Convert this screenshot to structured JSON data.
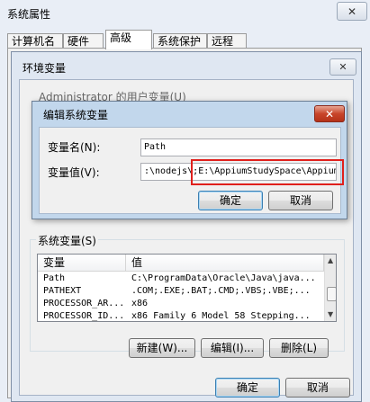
{
  "outer": {
    "title": "系统属性",
    "tabs": [
      "计算机名",
      "硬件",
      "高级",
      "系统保护",
      "远程"
    ],
    "active_tab": "高级"
  },
  "env": {
    "title": "环境变量",
    "user_vars_label": "Administrator 的用户变量(U)",
    "system_vars_label": "系统变量(S)",
    "columns": [
      "变量",
      "值"
    ],
    "rows": [
      {
        "name": "Path",
        "value": "C:\\ProgramData\\Oracle\\Java\\java..."
      },
      {
        "name": "PATHEXT",
        "value": ".COM;.EXE;.BAT;.CMD;.VBS;.VBE;..."
      },
      {
        "name": "PROCESSOR_AR...",
        "value": "x86"
      },
      {
        "name": "PROCESSOR_ID...",
        "value": "x86 Family 6 Model 58 Stepping..."
      }
    ],
    "buttons": {
      "new": "新建(W)...",
      "edit": "编辑(I)...",
      "delete": "删除(L)"
    },
    "ok": "确定",
    "cancel": "取消"
  },
  "edit": {
    "title": "编辑系统变量",
    "name_label": "变量名(N):",
    "name_value": "Path",
    "value_label": "变量值(V):",
    "value_value": ":\\nodejs\\;E:\\AppiumStudySpace\\Appium",
    "ok": "确定",
    "cancel": "取消"
  },
  "colors": {
    "highlight": "#e0201c",
    "close_red": "#c8452a"
  }
}
